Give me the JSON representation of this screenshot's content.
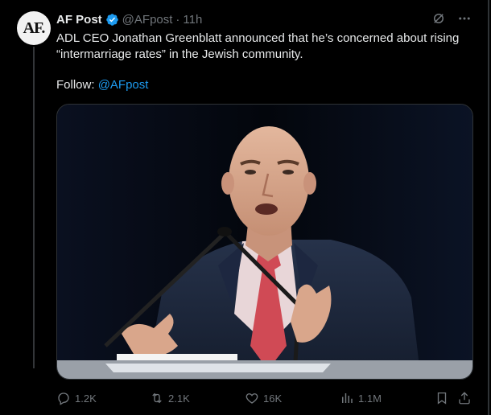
{
  "post": {
    "author_name": "AF Post",
    "handle": "@AFpost",
    "separator": "·",
    "time": "11h",
    "avatar_text": "AF.",
    "text": "ADL CEO Jonathan Greenblatt announced that he’s concerned about rising “intermarriage rates” in the Jewish community.",
    "follow_label": "Follow:",
    "follow_mention": "@AFpost"
  },
  "actions": {
    "reply_count": "1.2K",
    "repost_count": "2.1K",
    "like_count": "16K",
    "views_count": "1.1M"
  },
  "icons": {
    "verified": "verified-badge-icon",
    "grok": "grok-icon",
    "more": "more-icon",
    "reply": "reply-icon",
    "repost": "repost-icon",
    "like": "like-icon",
    "views": "views-icon",
    "bookmark": "bookmark-icon",
    "share": "share-icon"
  },
  "colors": {
    "background": "#000000",
    "text": "#e7e9ea",
    "muted": "#71767b",
    "accent": "#1d9bf0"
  }
}
